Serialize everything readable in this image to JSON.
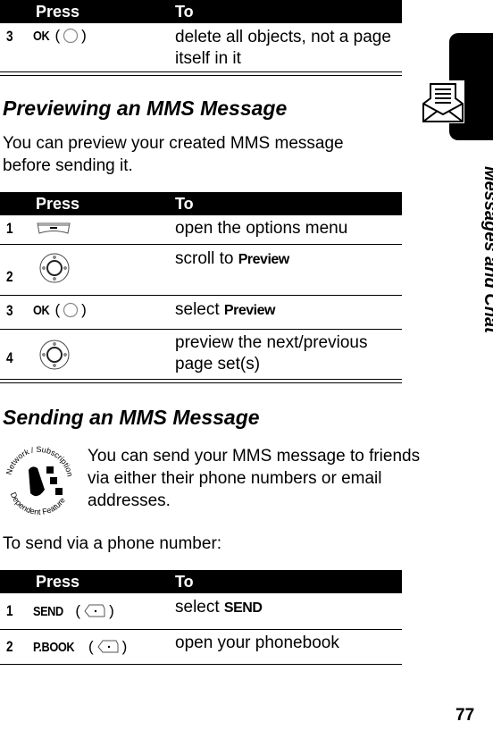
{
  "table1": {
    "header": {
      "press": "Press",
      "to": "To"
    },
    "rows": [
      {
        "num": "3",
        "key": "OK",
        "icon": "center-select-key",
        "to": "delete all objects, not a page itself in it"
      }
    ]
  },
  "section_preview": {
    "title": "Previewing an MMS Message",
    "intro": "You can preview your created MMS message before sending it.",
    "table": {
      "header": {
        "press": "Press",
        "to": "To"
      },
      "rows": [
        {
          "num": "1",
          "icon": "menu-key",
          "to": "open the options menu"
        },
        {
          "num": "2",
          "icon": "navigation-key",
          "to_prefix": "scroll to ",
          "to_key": "Preview"
        },
        {
          "num": "3",
          "key": "OK",
          "icon": "center-select-key",
          "to_prefix": "select ",
          "to_key": "Preview"
        },
        {
          "num": "4",
          "icon": "navigation-key",
          "to": "preview the next/previous page set(s)"
        }
      ]
    }
  },
  "section_send": {
    "title": "Sending an MMS Message",
    "badge_top": "Network / Subscription",
    "badge_bottom": "Dependent Feature",
    "intro": "You can send your MMS message to friends via either their phone numbers or email addresses.",
    "sub": "To send via a phone number:",
    "table": {
      "header": {
        "press": "Press",
        "to": "To"
      },
      "rows": [
        {
          "num": "1",
          "key": "SEND",
          "icon": "soft-key",
          "to_prefix": "select ",
          "to_key": "SEND"
        },
        {
          "num": "2",
          "key": "P.BOOK",
          "icon": "soft-key",
          "to": "open your phonebook"
        }
      ]
    }
  },
  "sidebar": {
    "chapter": "Messages and Chat",
    "icon": "envelope-icon"
  },
  "page_number": "77"
}
